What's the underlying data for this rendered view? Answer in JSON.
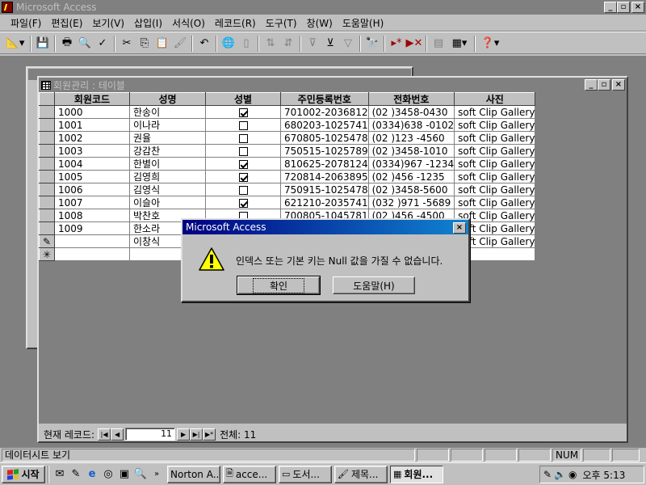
{
  "app": {
    "title": "Microsoft Access"
  },
  "menu": [
    "파일(F)",
    "편집(E)",
    "보기(V)",
    "삽입(I)",
    "서식(O)",
    "레코드(R)",
    "도구(T)",
    "창(W)",
    "도움말(H)"
  ],
  "toolbar": {
    "icons": [
      "design-view-icon",
      "save-icon",
      "print-icon",
      "print-preview-icon",
      "spelling-icon",
      "cut-icon",
      "copy-icon",
      "paste-icon",
      "format-painter-icon",
      "undo-icon",
      "insert-hyperlink-icon",
      "sort-ascending-icon",
      "sort-descending-icon",
      "filter-by-selection-icon",
      "filter-by-form-icon",
      "apply-filter-icon",
      "find-icon",
      "new-record-icon",
      "delete-record-icon",
      "properties-icon",
      "new-object-icon",
      "help-icon"
    ]
  },
  "table_window": {
    "title": "회원관리 : 테이블",
    "columns": [
      "회원코드",
      "성명",
      "성별",
      "주민등록번호",
      "전화번호",
      "사진"
    ],
    "rows": [
      {
        "code": "1000",
        "name": "한송이",
        "gender": true,
        "jumin": "701002-2036812",
        "phone": "(02  )3458-0430",
        "photo": "soft Clip Gallery"
      },
      {
        "code": "1001",
        "name": "이나라",
        "gender": false,
        "jumin": "680203-1025741",
        "phone": "(0334)638 -0102",
        "photo": "soft Clip Gallery"
      },
      {
        "code": "1002",
        "name": "권율",
        "gender": false,
        "jumin": "670805-1025478",
        "phone": "(02  )123 -4560",
        "photo": "soft Clip Gallery"
      },
      {
        "code": "1003",
        "name": "강감찬",
        "gender": false,
        "jumin": "750515-1025789",
        "phone": "(02  )3458-1010",
        "photo": "soft Clip Gallery"
      },
      {
        "code": "1004",
        "name": "한별이",
        "gender": true,
        "jumin": "810625-2078124",
        "phone": "(0334)967 -1234",
        "photo": "soft Clip Gallery"
      },
      {
        "code": "1005",
        "name": "김영희",
        "gender": true,
        "jumin": "720814-2063895",
        "phone": "(02  )456 -1235",
        "photo": "soft Clip Gallery"
      },
      {
        "code": "1006",
        "name": "김영식",
        "gender": false,
        "jumin": "750915-1025478",
        "phone": "(02  )3458-5600",
        "photo": "soft Clip Gallery"
      },
      {
        "code": "1007",
        "name": "이슬아",
        "gender": true,
        "jumin": "621210-2035741",
        "phone": "(032 )971 -5689",
        "photo": "soft Clip Gallery"
      },
      {
        "code": "1008",
        "name": "박찬호",
        "gender": false,
        "jumin": "700805-1045781",
        "phone": "(02  )456 -4500",
        "photo": "soft Clip Gallery"
      },
      {
        "code": "1009",
        "name": "한소라",
        "gender": false,
        "jumin": "",
        "phone": "",
        "photo": "soft Clip Gallery"
      },
      {
        "code": "",
        "name": "이창식",
        "gender": null,
        "jumin": "",
        "phone": "",
        "photo": "soft Clip Gallery",
        "editing": true
      },
      {
        "code": "",
        "name": "",
        "gender": null,
        "jumin": "",
        "phone": "",
        "photo": "",
        "new": true
      }
    ]
  },
  "navigation": {
    "label": "현재 레코드:",
    "current": "11",
    "total_label": "전체: 11"
  },
  "dialog": {
    "title": "Microsoft Access",
    "message": "인덱스 또는 기본 키는 Null 값을 가질 수 없습니다.",
    "ok_label": "확인",
    "help_label": "도움말(H)"
  },
  "statusbar": {
    "text": "데이터시트 보기",
    "num": "NUM"
  },
  "taskbar": {
    "start_label": "시작",
    "tasks": [
      "Norton A...",
      "acce...",
      "도서...",
      "제목...",
      "회원..."
    ],
    "clock": "오후 5:13"
  },
  "colors": {
    "title_active": "#000080",
    "title_inactive": "#808080",
    "face": "#c0c0c0",
    "mdi_bg": "#808080"
  }
}
